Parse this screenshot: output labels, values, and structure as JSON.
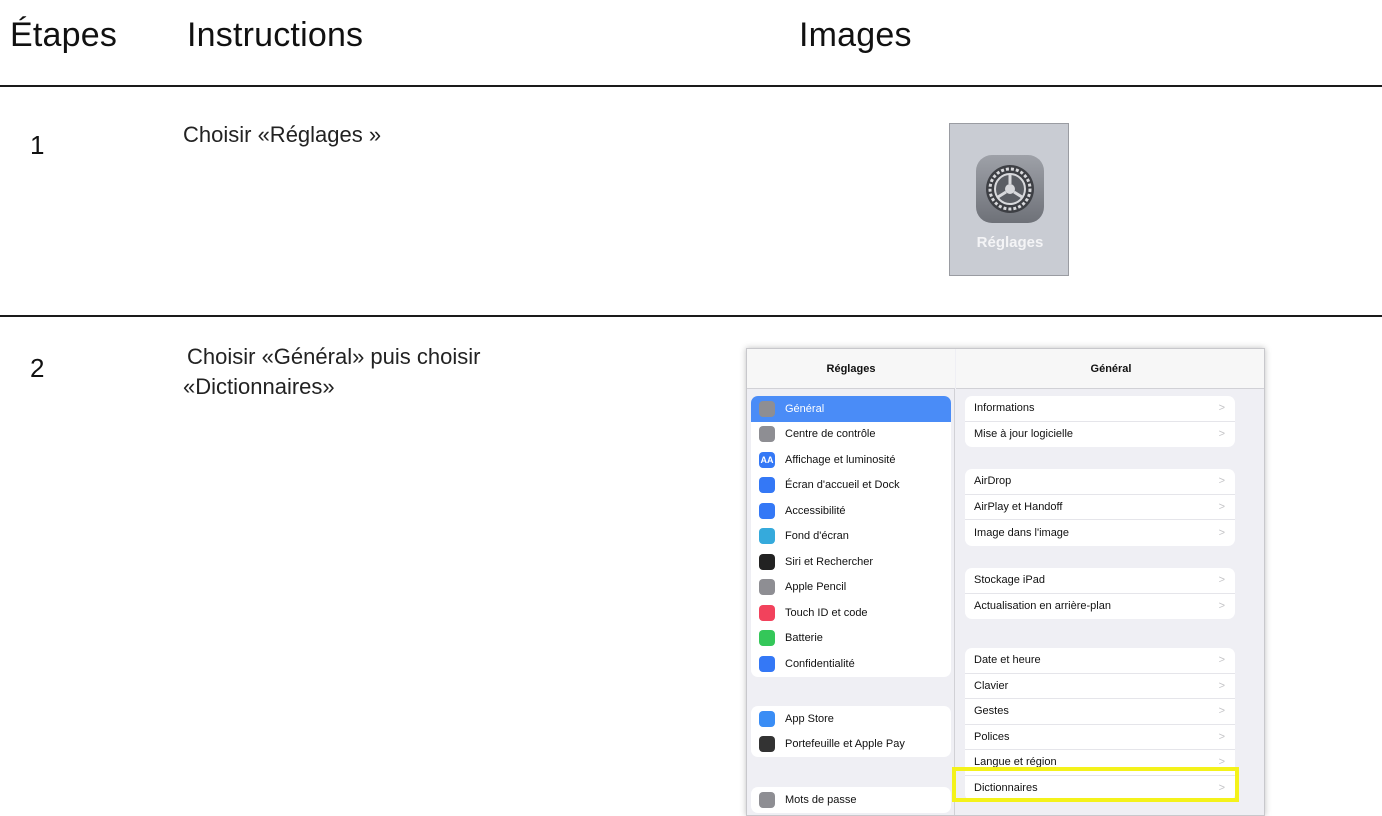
{
  "headers": {
    "steps": "Étapes",
    "instructions": "Instructions",
    "images": "Images"
  },
  "steps": [
    {
      "number": "1",
      "instruction": "Choisir «Réglages »"
    },
    {
      "number": "2",
      "instruction_line1": "Choisir «Général» puis choisir",
      "instruction_line2": "«Dictionnaires»"
    }
  ],
  "app_icon": {
    "label": "Réglages",
    "icon": "gear-icon"
  },
  "ipad": {
    "left_title": "Réglages",
    "right_title": "Général",
    "sidebar_group1": [
      {
        "label": "Général",
        "icon": "gear-icon",
        "color": "#8e8e93",
        "selected": true
      },
      {
        "label": "Centre de contrôle",
        "icon": "toggles-icon",
        "color": "#8e8e93"
      },
      {
        "label": "Affichage et luminosité",
        "icon": "text-size-icon",
        "color": "#3478f6",
        "glyph": "AA"
      },
      {
        "label": "Écran d'accueil et Dock",
        "icon": "home-grid-icon",
        "color": "#3478f6"
      },
      {
        "label": "Accessibilité",
        "icon": "accessibility-icon",
        "color": "#3478f6"
      },
      {
        "label": "Fond d'écran",
        "icon": "wallpaper-icon",
        "color": "#35aadc"
      },
      {
        "label": "Siri et Rechercher",
        "icon": "siri-icon",
        "color": "#222222"
      },
      {
        "label": "Apple Pencil",
        "icon": "pencil-icon",
        "color": "#8e8e93"
      },
      {
        "label": "Touch ID et code",
        "icon": "fingerprint-icon",
        "color": "#f2425c"
      },
      {
        "label": "Batterie",
        "icon": "battery-icon",
        "color": "#34c759"
      },
      {
        "label": "Confidentialité",
        "icon": "hand-icon",
        "color": "#3478f6"
      }
    ],
    "sidebar_group2": [
      {
        "label": "App Store",
        "icon": "app-store-icon",
        "color": "#3a8df5"
      },
      {
        "label": "Portefeuille et Apple Pay",
        "icon": "wallet-icon",
        "color": "#333333"
      }
    ],
    "sidebar_group3": [
      {
        "label": "Mots de passe",
        "icon": "key-icon",
        "color": "#8e8e93"
      }
    ],
    "general_groups": [
      [
        "Informations",
        "Mise à jour logicielle"
      ],
      [
        "AirDrop",
        "AirPlay et Handoff",
        "Image dans l'image"
      ],
      [
        "Stockage iPad",
        "Actualisation en arrière-plan"
      ],
      [
        "Date et heure",
        "Clavier",
        "Gestes",
        "Polices",
        "Langue et région",
        "Dictionnaires"
      ]
    ],
    "chevron": ">"
  }
}
